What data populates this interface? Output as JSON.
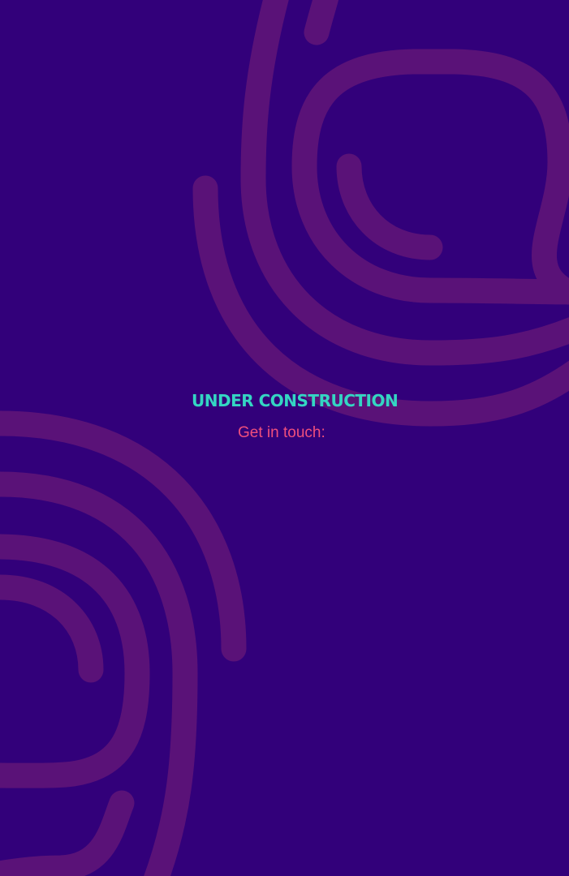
{
  "page": {
    "title": "UNDER CONSTRUCTION",
    "contact_label": "Get in touch:"
  },
  "colors": {
    "background": "#32007a",
    "swirl": "#5a1278",
    "title": "#34d6c3",
    "contact": "#f04f7d"
  }
}
